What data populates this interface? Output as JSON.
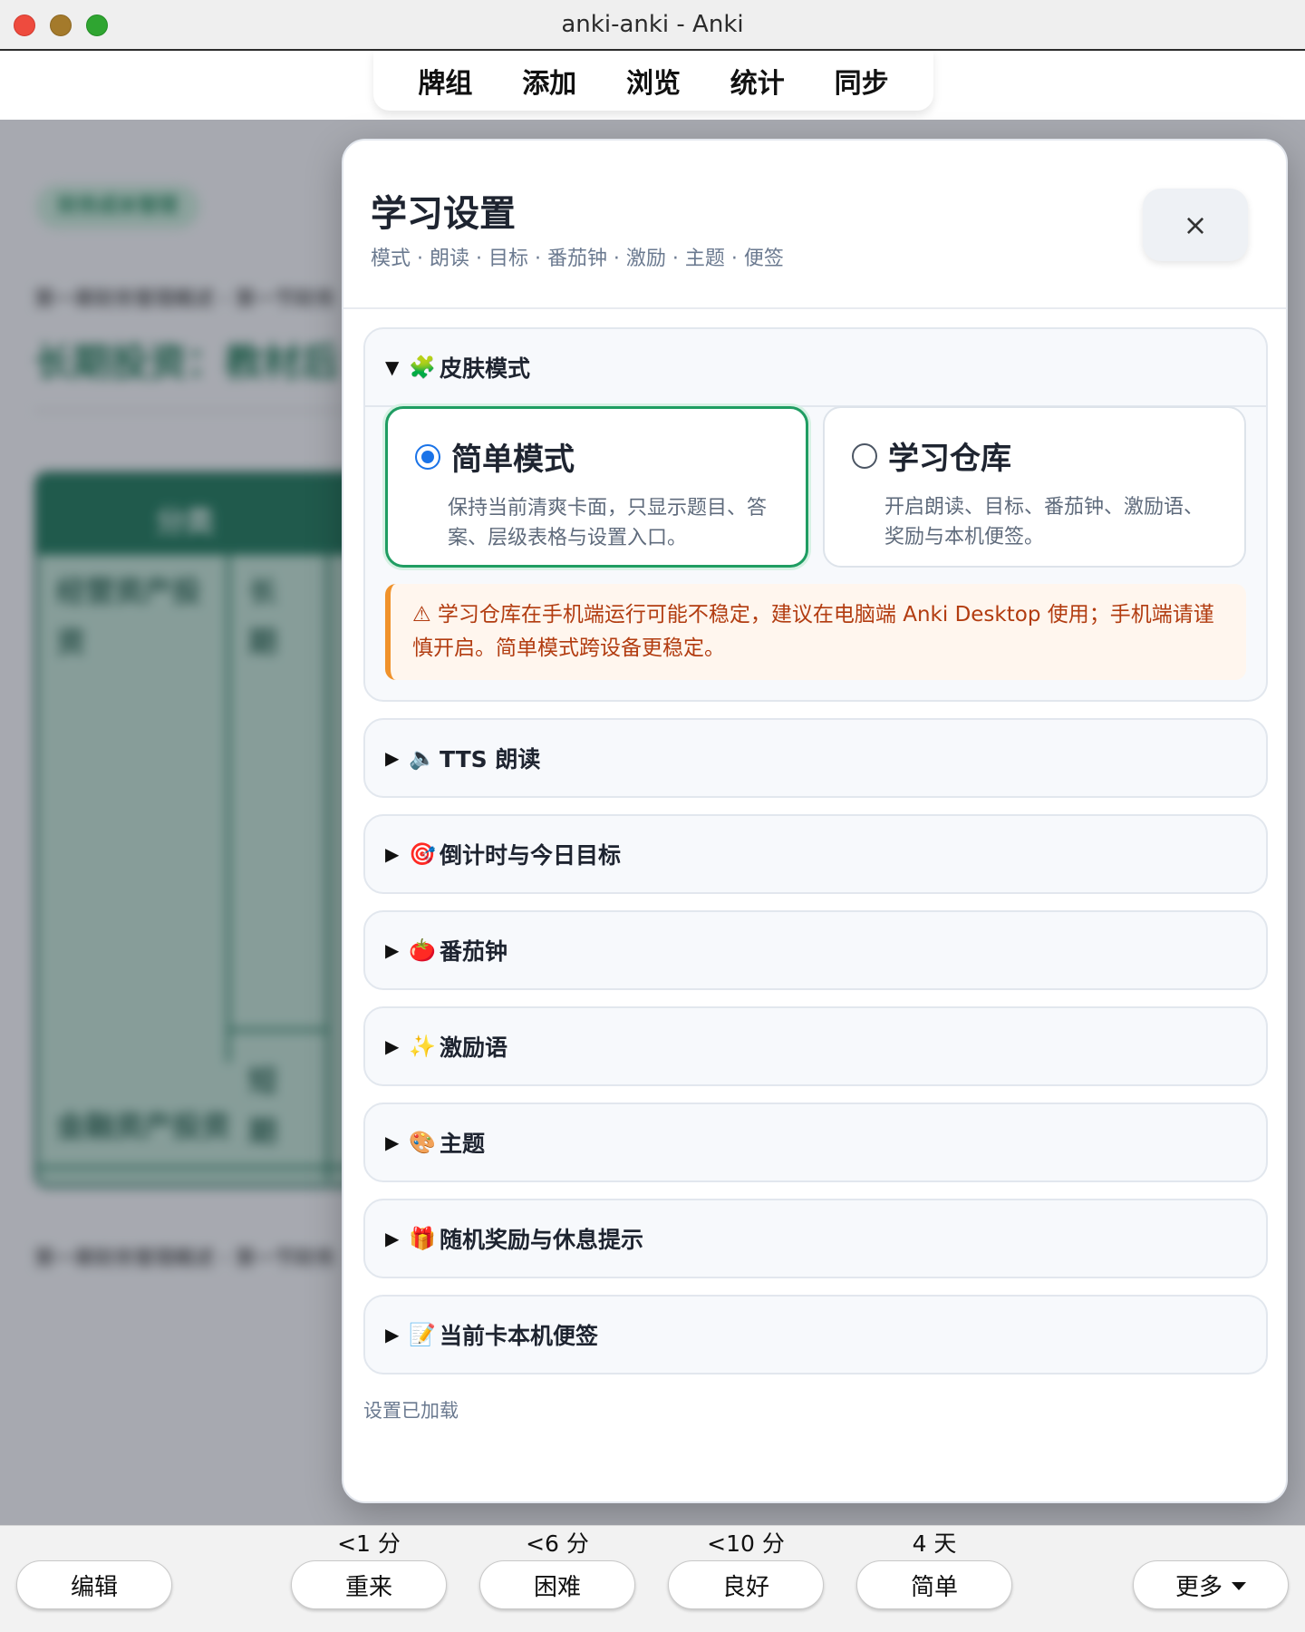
{
  "window": {
    "title": "anki-anki - Anki"
  },
  "nav": {
    "items": [
      "牌组",
      "添加",
      "浏览",
      "统计",
      "同步"
    ]
  },
  "background_card": {
    "tag": "财务成本管理",
    "breadcrumb": "第一章财务管理概述 · 第一节财务",
    "title": "长期投资：教材后",
    "table_header": "分类",
    "cells": {
      "operating_asset": "经营资产投资",
      "long": "长期",
      "short": "短期",
      "financial_asset": "金融资产投资"
    },
    "breadcrumb_bottom": "第一章财务管理概述 · 第一节财务"
  },
  "modal": {
    "title": "学习设置",
    "subtitle": "模式 · 朗读 · 目标 · 番茄钟 · 激励 · 主题 · 便签",
    "close_icon": "×",
    "skin_section": {
      "title": "皮肤模式",
      "emoji": "🧩",
      "expanded": true,
      "modes": [
        {
          "name": "简单模式",
          "desc": "保持当前清爽卡面，只显示题目、答案、层级表格与设置入口。",
          "selected": true
        },
        {
          "name": "学习仓库",
          "desc": "开启朗读、目标、番茄钟、激励语、奖励与本机便签。",
          "selected": false
        }
      ],
      "warning": "⚠ 学习仓库在手机端运行可能不稳定，建议在电脑端 Anki Desktop 使用；手机端请谨慎开启。简单模式跨设备更稳定。"
    },
    "sections": [
      {
        "emoji": "🔈",
        "title": "TTS 朗读"
      },
      {
        "emoji": "🎯",
        "title": "倒计时与今日目标"
      },
      {
        "emoji": "🍅",
        "title": "番茄钟"
      },
      {
        "emoji": "✨",
        "title": "激励语"
      },
      {
        "emoji": "🎨",
        "title": "主题"
      },
      {
        "emoji": "🎁",
        "title": "随机奖励与休息提示"
      },
      {
        "emoji": "📝",
        "title": "当前卡本机便签"
      }
    ],
    "status": "设置已加载"
  },
  "bottom": {
    "edit": "编辑",
    "answers": [
      {
        "interval": "<1 分",
        "label": "重来"
      },
      {
        "interval": "<6 分",
        "label": "困难"
      },
      {
        "interval": "<10 分",
        "label": "良好"
      },
      {
        "interval": "4 天",
        "label": "简单"
      }
    ],
    "more": "更多"
  },
  "colors": {
    "accent_green": "#1f9d62",
    "radio_blue": "#1a73e8",
    "warning_text": "#b23c10",
    "warning_border": "#f0922b"
  }
}
